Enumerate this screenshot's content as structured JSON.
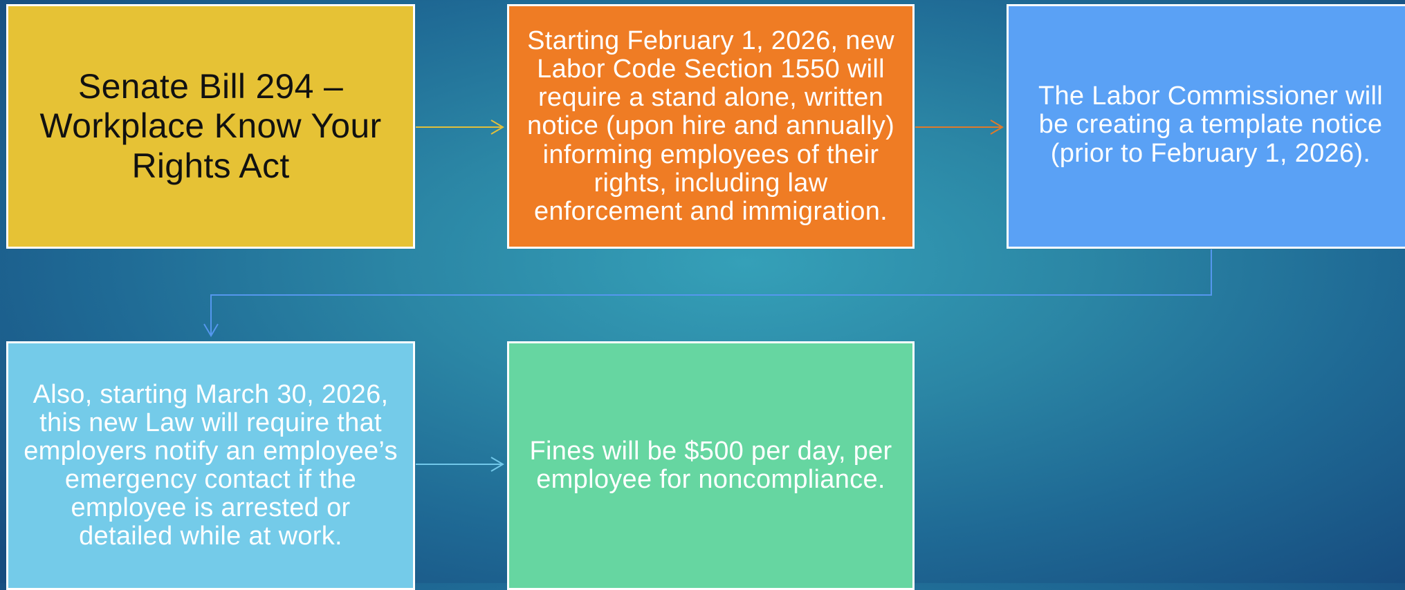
{
  "diagram": {
    "colors": {
      "box_yellow": "#e6c235",
      "box_orange": "#ef7c24",
      "box_blue": "#5aa1f5",
      "box_lightblue": "#74cbe9",
      "box_green": "#66d6a1",
      "connector_yellow": "#e2c03b",
      "connector_orange": "#e07a2a",
      "connector_blue": "#5597ee",
      "connector_lightblue": "#72c8ea"
    },
    "boxes": [
      {
        "id": "b1",
        "text": "Senate Bill 294 – Workplace Know Your Rights Act"
      },
      {
        "id": "b2",
        "text": "Starting February 1, 2026, new Labor Code Section 1550 will require a stand alone, written notice (upon hire and annually) informing employees of their rights, including law enforcement and immigration."
      },
      {
        "id": "b3",
        "text": "The Labor Commissioner will be creating a template notice (prior to February 1, 2026)."
      },
      {
        "id": "b4",
        "text": "Also, starting March 30, 2026, this new Law will require that employers notify an employee’s emergency contact if the employee is arrested or detailed while at work."
      },
      {
        "id": "b5",
        "text": "Fines will be $500 per day, per employee for noncompliance."
      }
    ]
  }
}
